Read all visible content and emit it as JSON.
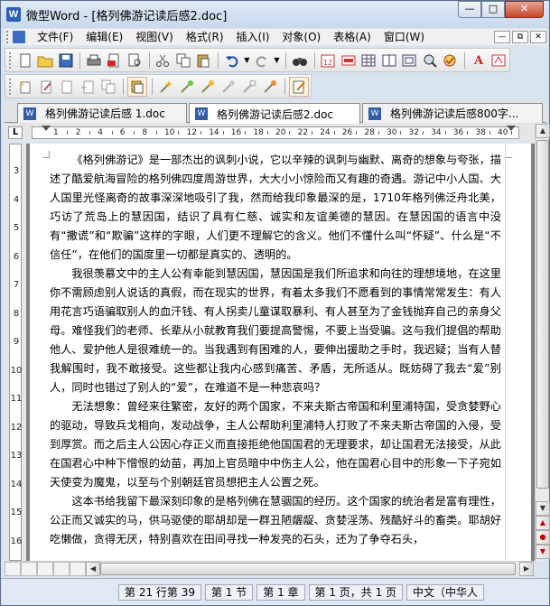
{
  "window": {
    "title": "微型Word - [格列佛游记读后感2.doc]",
    "app_icon": "W"
  },
  "menu": {
    "items": [
      "文件(F)",
      "编辑(E)",
      "视图(V)",
      "格式(R)",
      "插入(I)",
      "对象(O)",
      "表格(A)",
      "窗口(W)"
    ]
  },
  "tabs": [
    {
      "label": "格列佛游记读后感 1.doc"
    },
    {
      "label": "格列佛游记读后感2.doc"
    },
    {
      "label": "格列佛游记读后感800字..."
    }
  ],
  "ruler": {
    "corner": "L",
    "numbers": [
      "1",
      "2",
      "4",
      "6",
      "8",
      "10",
      "12",
      "14",
      "16",
      "18",
      "20",
      "22",
      "24",
      "26",
      "28",
      "30",
      "32",
      "34",
      "36",
      "38",
      "40"
    ]
  },
  "vruler": {
    "numbers": [
      "3",
      "4",
      "5",
      "6",
      "7",
      "8",
      "9",
      "10",
      "11",
      "12",
      "13",
      "14",
      "15",
      "16"
    ]
  },
  "document": {
    "paragraphs": [
      "《格列佛游记》是一部杰出的讽刺小说，它以辛辣的讽刺与幽默、离奇的想象与夸张，描述了酷爱航海冒险的格列佛四度周游世界，大大小小惊险而又有趣的奇遇。游记中小人国、大人国里光怪离奇的故事深深地吸引了我，然而给我印象最深的是，1710年格列佛泛舟北美，巧访了荒岛上的慧因国，结识了具有仁慈、诚实和友谊美德的慧因。在慧因国的语言中没有“撒谎”和“欺骗”这样的字眼，人们更不理解它的含义。他们不懂什么叫“怀疑”、什么是“不信任”，在他们的国度里一切都是真实的、透明的。",
      "我很羡慕文中的主人公有幸能到慧因国，慧因国是我们所追求和向往的理想境地，在这里你不需顾虑别人说话的真假，而在现实的世界，有着太多我们不愿看到的事情常常发生：有人用花言巧语骗取别人的血汗钱、有人拐卖儿童谋取暴利、有人甚至为了金钱抛弃自己的亲身父母。难怪我们的老师、长辈从小就教育我们要提高警惕，不要上当受骗。这与我们提倡的帮助他人、爱护他人是很难统一的。当我遇到有困难的人，要伸出援助之手时，我迟疑；当有人替我解围时，我不敢接受。这些都让我内心感到痛苦、矛盾，无所适从。既妨碍了我去“爱”别人，同时也错过了别人的“爱”，在难道不是一种悲哀吗？",
      "无法想象：曾经来往繁密，友好的两个国家，不来夫斯古帝国和利里浦特国，受贪婪野心的驱动，导致兵戈相向，发动战争，主人公帮助利里浦特人打败了不来夫斯古帝国的入侵，受到厚赏。而之后主人公因心存正义而直接拒绝他国国君的无理要求，却让国君无法接受，从此在国君心中种下憎恨的幼苗，再加上官员暗中中伤主人公，他在国君心目中的形象一下子宛如天使变为魔鬼，以至与个别朝廷官员想把主人公置之死。",
      "这本书给我留下最深刻印象的是格列佛在慧骃国的经历。这个国家的统治者是富有理性，公正而又诚实的马，供马驱使的耶胡却是一群丑陋龌龊、贪婪淫荡、残酷好斗的畜类。耶胡好吃懒做，贪得无厌，特别喜欢在田间寻找一种发亮的石头，还为了争夺石头，"
    ]
  },
  "status": {
    "cells": [
      "第 21 行第 39",
      "第 1 节",
      "第 1 章",
      "第 1 页，共 1 页",
      "中文（中华人"
    ]
  },
  "colors": {
    "titlebar": "#dfe9f5",
    "close_button": "#c8442a",
    "word_blue": "#2b5fb4"
  }
}
